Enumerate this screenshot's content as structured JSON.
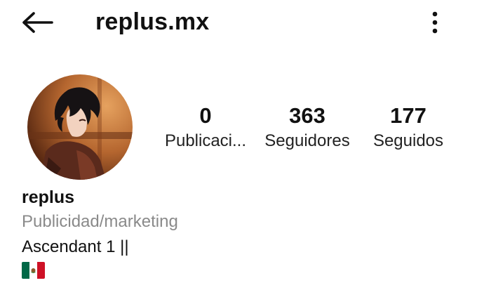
{
  "header": {
    "username": "replus.mx",
    "back_icon": "arrow-left-icon",
    "more_icon": "more-vertical-icon"
  },
  "profile": {
    "avatar": "profile-avatar",
    "stats": [
      {
        "value": "0",
        "label": "Publicaci..."
      },
      {
        "value": "363",
        "label": "Seguidores"
      },
      {
        "value": "177",
        "label": "Seguidos"
      }
    ],
    "name": "replus",
    "category": "Publicidad/marketing",
    "bio_lines": [
      "Ascendant 1 ||"
    ],
    "flag": "mexico-flag-icon"
  },
  "colors": {
    "text": "#111111",
    "muted": "#8a8a8a",
    "flag_green": "#006847",
    "flag_white": "#ffffff",
    "flag_red": "#ce1126"
  }
}
